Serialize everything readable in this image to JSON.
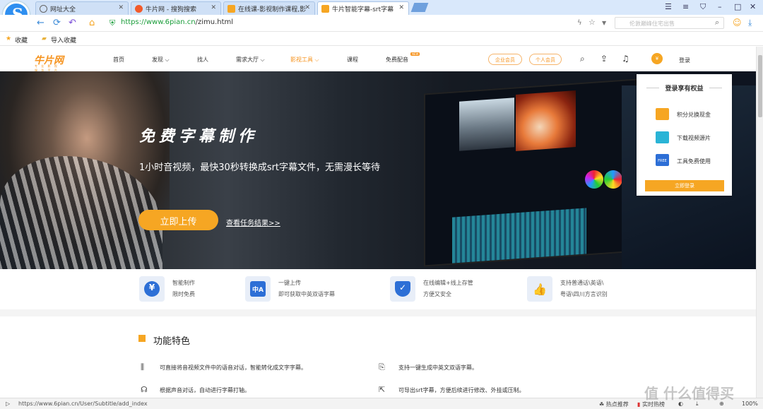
{
  "browser": {
    "tabs": [
      {
        "label": "网址大全",
        "active": false
      },
      {
        "label": "牛片网 - 搜狗搜索",
        "active": false
      },
      {
        "label": "在线课-影视制作课程,影",
        "active": false
      },
      {
        "label": "牛片智能字幕-srt字幕",
        "active": true
      }
    ],
    "url_prefix": "https://www.6pian.cn",
    "url_path": "/zimu.html",
    "search_placeholder": "伦敦巅峰住宅出售",
    "bookmarks": [
      "收藏",
      "导入收藏"
    ],
    "status_url": "https://www.6pian.cn/User/Subtitle/add_index",
    "status_items": [
      "热点推荐",
      "实时热榜",
      "100%"
    ]
  },
  "site": {
    "brand": "牛片网",
    "brand_tagline": "专 业 影 视 服 务 平 台",
    "nav": [
      {
        "label": "首页"
      },
      {
        "label": "发现 ⌵"
      },
      {
        "label": "找人"
      },
      {
        "label": "需求大厅 ⌵"
      },
      {
        "label": "影视工具 ⌵"
      },
      {
        "label": "课程"
      },
      {
        "label": "免费配音"
      }
    ],
    "new_badge": "NEW",
    "vip_buttons": [
      "企业会员",
      "个人会员"
    ],
    "login": "登录",
    "hero": {
      "title": "免费字幕制作",
      "subtitle": "1小时音视频，最快30秒转换成srt字幕文件，无需漫长等待",
      "upload_button": "立即上传",
      "task_link": "查看任务结果>>"
    },
    "panel": {
      "title": "登录享有权益",
      "items": [
        "积分兑换现金",
        "下载视频源片",
        "工具免费使用"
      ],
      "button": "立即登录",
      "free_tag": "FREE"
    },
    "features": [
      {
        "line1": "智能制作",
        "line2": "限时免费",
        "icon": "yuan-icon"
      },
      {
        "line1": "一键上传",
        "line2": "即可获取中英双语字幕",
        "icon": "translate-icon"
      },
      {
        "line1": "在线编辑+线上存管",
        "line2": "方便又安全",
        "icon": "shield-check-icon"
      },
      {
        "line1": "支持普通话\\英语\\",
        "line2": "粤语\\四川方言识别",
        "icon": "thumbs-up-icon"
      }
    ],
    "section_title": "功能特色",
    "feature_rows": [
      "可直接将音视频文件中的语音对话，智能转化成文字字幕。",
      "支持一键生成中英文双语字幕。",
      "根据声音对话，自动进行字幕打轴。",
      "可导出srt字幕，方便后续进行修改、外挂或压制。"
    ]
  },
  "watermark": "值 什么值得买",
  "colors": {
    "accent": "#f6a623",
    "tab_bg": "#d9e8fb",
    "url_green": "#1a9d3a",
    "icon_blue": "#2d6fd6"
  }
}
